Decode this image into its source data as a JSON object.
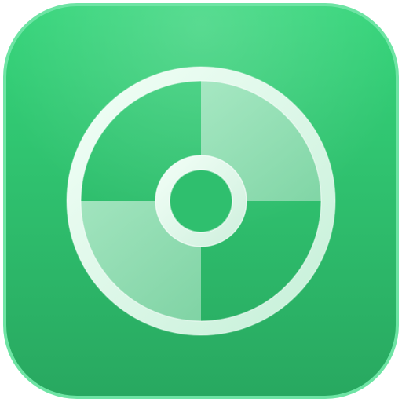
{
  "icon": {
    "name": "disc-icon",
    "colors": {
      "tile_top": "#35D57A",
      "tile_bottom": "#28A860",
      "tile_border": "#6EE4A4",
      "ring_light": "#F2FFF7",
      "ring_mid": "#C5F0D8",
      "quadrant_fill": "#9EE3BD"
    }
  }
}
